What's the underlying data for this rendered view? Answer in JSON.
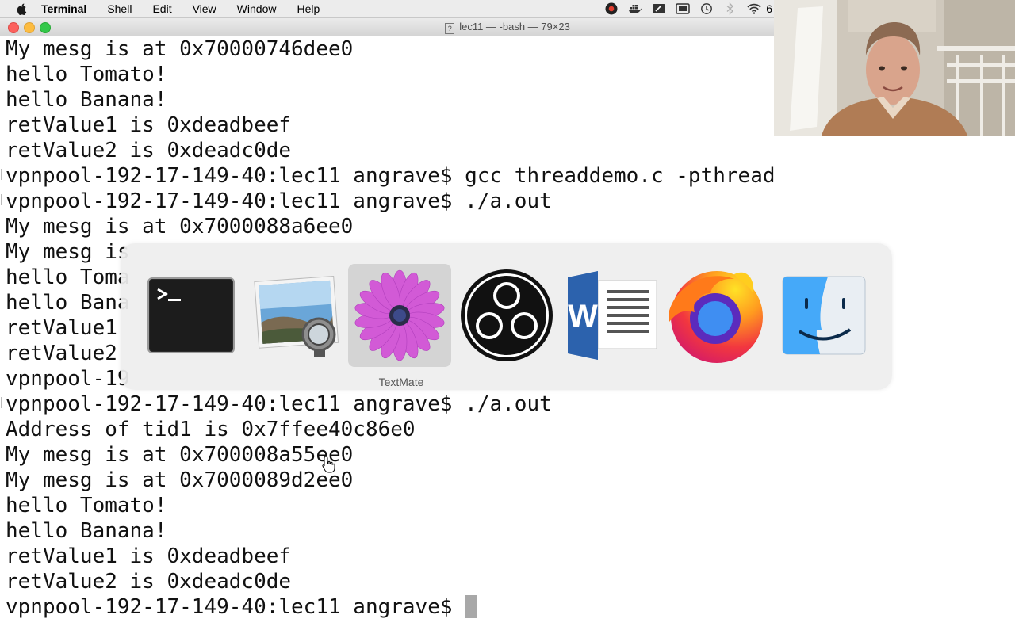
{
  "menubar": {
    "app_name": "Terminal",
    "menus": [
      "Shell",
      "Edit",
      "View",
      "Window",
      "Help"
    ],
    "status_truncated": "6"
  },
  "window": {
    "title": "lec11 — -bash — 79×23"
  },
  "terminal": {
    "lines": [
      "My mesg is at 0x70000746dee0",
      "hello Tomato!",
      "hello Banana!",
      "retValue1 is 0xdeadbeef",
      "retValue2 is 0xdeadc0de",
      "vpnpool-192-17-149-40:lec11 angrave$ gcc threaddemo.c -pthread",
      "vpnpool-192-17-149-40:lec11 angrave$ ./a.out",
      "My mesg is at 0x7000088a6ee0",
      "My mesg is",
      "hello Toma",
      "hello Bana",
      "retValue1",
      "retValue2",
      "vpnpool-19",
      "vpnpool-192-17-149-40:lec11 angrave$ ./a.out",
      "Address of tid1 is 0x7ffee40c86e0",
      "My mesg is at 0x700008a55ee0",
      "My mesg is at 0x7000089d2ee0",
      "hello Tomato!",
      "hello Banana!",
      "retValue1 is 0xdeadbeef",
      "retValue2 is 0xdeadc0de",
      "vpnpool-192-17-149-40:lec11 angrave$ "
    ]
  },
  "app_switcher": {
    "selected_label": "TextMate",
    "apps": [
      {
        "icon": "terminal-app-icon"
      },
      {
        "icon": "preview-app-icon"
      },
      {
        "icon": "textmate-app-icon",
        "selected": true
      },
      {
        "icon": "obs-app-icon"
      },
      {
        "icon": "word-app-icon"
      },
      {
        "icon": "firefox-app-icon"
      },
      {
        "icon": "finder-app-icon"
      }
    ]
  },
  "colors": {
    "terminal_bg": "#ffffff",
    "terminal_text": "#111111",
    "close": "#fc615d",
    "minimize": "#fdbc40",
    "maximize": "#34c84a"
  }
}
